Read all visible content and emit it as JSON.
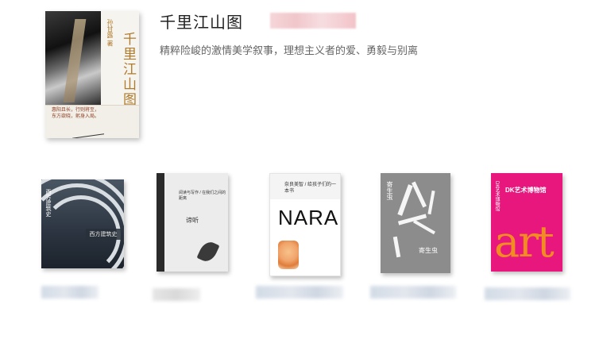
{
  "featured": {
    "title": "千里江山图",
    "description": "精粹险峻的激情美学叙事，理想主义者的爱、勇毅与别离",
    "cover": {
      "vertical_title": "千里江山图",
      "author": "孙甘露 著",
      "quote": "惠阳且长，行则将至，东方欲晓，躬身入局。"
    }
  },
  "books": [
    {
      "cover_title": "西方建筑史",
      "cover_side": "西方建筑史"
    },
    {
      "cover_title": "谛听",
      "cover_text": "阅读与写作 / 在我们之间的距离"
    },
    {
      "cover_big": "NARA",
      "cover_small": "奈良美智 / 给孩子们的一本书"
    },
    {
      "cover_side": "寄生虫",
      "cover_bottom": "寄生虫"
    },
    {
      "cover_dk": "DK艺术博物馆",
      "cover_art": "art"
    }
  ],
  "colors": {
    "title_text": "#222222",
    "desc_text": "#666666",
    "dk_pink": "#e8177e",
    "dk_orange": "#f08c21"
  }
}
